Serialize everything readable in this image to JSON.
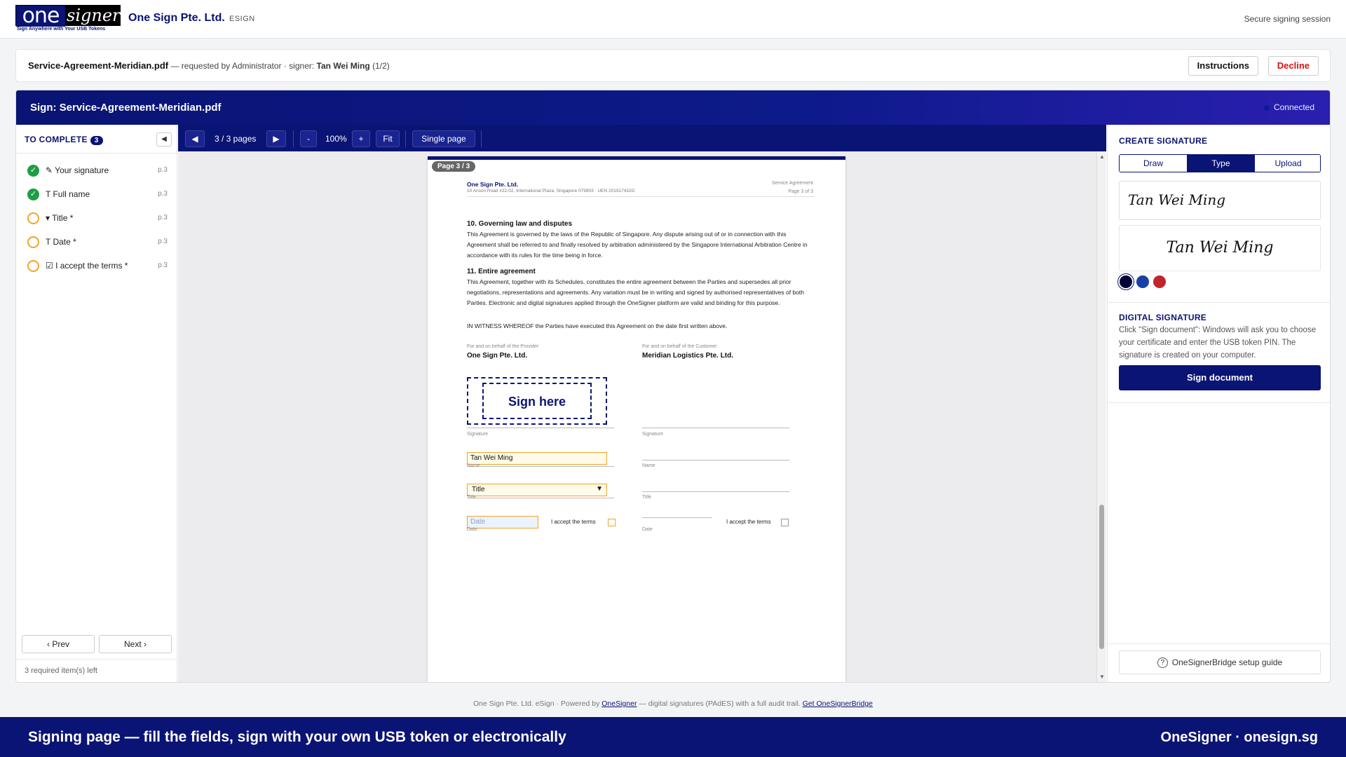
{
  "header": {
    "logo_one": "one",
    "logo_signer": "signer",
    "logo_tagline": "Sign Anywhere with Your USB Tokens",
    "company": "One Sign Pte. Ltd.",
    "product": "ESIGN",
    "session": "Secure signing session"
  },
  "infobar": {
    "filename": "Service-Agreement-Meridian.pdf",
    "requested": " — requested by Administrator · signer: ",
    "signer": "Tan Wei Ming",
    "signer_count": " (1/2)",
    "instructions_label": "Instructions",
    "decline_label": "Decline"
  },
  "sign_panel": {
    "title": "Sign: Service-Agreement-Meridian.pdf",
    "status": "Connected"
  },
  "checklist": {
    "heading": "TO COMPLETE",
    "count": "3",
    "collapse_icon": "◀",
    "items": [
      {
        "label": "✎ Your signature",
        "page": "p.3",
        "state": "done"
      },
      {
        "label": "T Full name",
        "page": "p.3",
        "state": "done"
      },
      {
        "label": "▾ Title *",
        "page": "p.3",
        "state": "todo"
      },
      {
        "label": "T Date *",
        "page": "p.3",
        "state": "todo"
      },
      {
        "label": "☑ I accept the terms *",
        "page": "p.3",
        "state": "todo"
      }
    ],
    "prev_label": "‹ Prev",
    "next_label": "Next ›",
    "remaining": "3 required item(s) left"
  },
  "viewer": {
    "prev_icon": "◀",
    "next_icon": "▶",
    "page_indicator": "3 / 3 pages",
    "zoom_out": "-",
    "zoom": "100%",
    "zoom_in": "+",
    "fit_label": "Fit",
    "mode_label": "Single page",
    "page_label": "Page 3 / 3"
  },
  "document": {
    "company": "One Sign Pte. Ltd.",
    "address": "10 Anson Road #22-02, International Plaza, Singapore 079903  ·  UEN 201917432G",
    "doc_type": "Service Agreement",
    "page_of": "Page 3 of 3",
    "s10_heading": "10. Governing law and disputes",
    "s10_body": "This Agreement is governed by the laws of the Republic of Singapore. Any dispute arising out of or in connection with this Agreement shall be referred to and finally resolved by arbitration administered by the Singapore International Arbitration Centre in accordance with its rules for the time being in force.",
    "s11_heading": "11. Entire agreement",
    "s11_body": "This Agreement, together with its Schedules, constitutes the entire agreement between the Parties and supersedes all prior negotiations, representations and agreements. Any variation must be in writing and signed by authorised representatives of both Parties. Electronic and digital signatures applied through the OneSigner platform are valid and binding for this purpose.",
    "witness": "IN WITNESS WHEREOF the Parties have executed this Agreement on the date first written above.",
    "provider_caption": "For and on behalf of the Provider",
    "provider_name": "One Sign Pte. Ltd.",
    "customer_caption": "For and on behalf of the Customer",
    "customer_name": "Meridian Logistics Pte. Ltd.",
    "sign_here": "Sign here",
    "signature_label": "Signature",
    "name_label": "Name",
    "name_value": "Tan Wei Ming",
    "title_label": "Title",
    "title_value": "Title",
    "date_label": "Date",
    "date_placeholder": "Date",
    "accept_label": "I accept the terms"
  },
  "create_signature": {
    "heading": "CREATE SIGNATURE",
    "tabs": [
      "Draw",
      "Type",
      "Upload"
    ],
    "active_tab": "Type",
    "typed_value": "Tan Wei Ming",
    "preview": "Tan Wei Ming",
    "colors": [
      "#000033",
      "#1a3fa8",
      "#c0242c"
    ]
  },
  "digital_signature": {
    "heading": "DIGITAL SIGNATURE",
    "description": "Click \"Sign document\": Windows will ask you to choose your certificate and enter the USB token PIN. The signature is created on your computer.",
    "button": "Sign document",
    "guide": "OneSignerBridge setup guide"
  },
  "footer": {
    "note_prefix": "One Sign Pte. Ltd. eSign · Powered by ",
    "note_link1": "OneSigner",
    "note_mid": " — digital signatures (PAdES) with a full audit trail. ",
    "note_link2": "Get OneSignerBridge",
    "banner_left": "Signing page — fill the fields, sign with your own USB token or electronically",
    "banner_right": "OneSigner · onesign.sg"
  }
}
